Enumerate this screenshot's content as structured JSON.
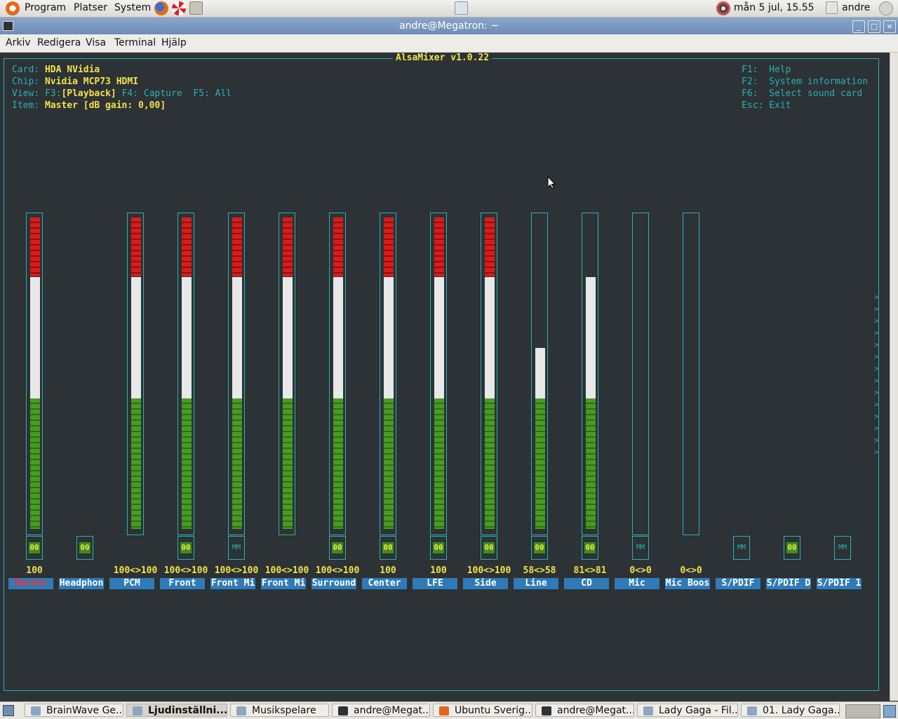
{
  "top_panel": {
    "menus": [
      "Program",
      "Platser",
      "System"
    ],
    "clock": "mån  5 jul, 15.55",
    "user": "andre",
    "icons": [
      "ubuntu-logo-icon",
      "firefox-icon",
      "help-lifebuoy-icon",
      "home-folder-icon",
      "screenshot-tool-icon",
      "volume-icon",
      "user-icon",
      "power-icon"
    ]
  },
  "window": {
    "title": "andre@Megatron: ~"
  },
  "menubar": [
    "Arkiv",
    "Redigera",
    "Visa",
    "Terminal",
    "Hjälp"
  ],
  "mixer": {
    "title": "AlsaMixer v1.0.22",
    "card_label": "Card:",
    "card": "HDA NVidia",
    "chip_label": "Chip:",
    "chip": "Nvidia MCP73 HDMI",
    "view_label": "View:",
    "f3": "F3:",
    "view_playback": "[Playback]",
    "view_capture": "F4: Capture",
    "view_all": "F5: All",
    "item_label": "Item:",
    "item": "Master [dB gain: 0,00]",
    "help": [
      {
        "key": "F1:",
        "text": "Help"
      },
      {
        "key": "F2:",
        "text": "System information"
      },
      {
        "key": "F6:",
        "text": "Select sound card"
      },
      {
        "key": "Esc:",
        "text": "Exit"
      }
    ],
    "channels": [
      {
        "name": "Master",
        "volume": "100",
        "level": 100,
        "has_bar": true,
        "switch": "00",
        "selected": true
      },
      {
        "name": "Headphon",
        "volume": "",
        "level": 0,
        "has_bar": false,
        "switch": "00"
      },
      {
        "name": "PCM",
        "volume": "100<>100",
        "level": 100,
        "has_bar": true,
        "switch": ""
      },
      {
        "name": "Front",
        "volume": "100<>100",
        "level": 100,
        "has_bar": true,
        "switch": "00"
      },
      {
        "name": "Front Mi",
        "volume": "100<>100",
        "level": 100,
        "has_bar": true,
        "switch": "MM"
      },
      {
        "name": "Front Mi",
        "volume": "100<>100",
        "level": 100,
        "has_bar": true,
        "switch": ""
      },
      {
        "name": "Surround",
        "volume": "100<>100",
        "level": 100,
        "has_bar": true,
        "switch": "00"
      },
      {
        "name": "Center",
        "volume": "100",
        "level": 100,
        "has_bar": true,
        "switch": "00"
      },
      {
        "name": "LFE",
        "volume": "100",
        "level": 100,
        "has_bar": true,
        "switch": "00"
      },
      {
        "name": "Side",
        "volume": "100<>100",
        "level": 100,
        "has_bar": true,
        "switch": "00"
      },
      {
        "name": "Line",
        "volume": "58<>58",
        "level": 58,
        "has_bar": true,
        "switch": "00"
      },
      {
        "name": "CD",
        "volume": "81<>81",
        "level": 81,
        "has_bar": true,
        "switch": "00"
      },
      {
        "name": "Mic",
        "volume": "0<>0",
        "level": 0,
        "has_bar": true,
        "switch": "MM"
      },
      {
        "name": "Mic Boos",
        "volume": "0<>0",
        "level": 0,
        "has_bar": true,
        "switch": ""
      },
      {
        "name": "S/PDIF",
        "volume": "",
        "level": 0,
        "has_bar": false,
        "switch": "MM"
      },
      {
        "name": "S/PDIF D",
        "volume": "",
        "level": 0,
        "has_bar": false,
        "switch": "00"
      },
      {
        "name": "S/PDIF 1",
        "volume": "",
        "level": 0,
        "has_bar": false,
        "switch": "MM"
      }
    ]
  },
  "taskbar": [
    {
      "label": "BrainWave Ge...",
      "icon": "brainwave-icon"
    },
    {
      "label": "Ljudinställni...",
      "icon": "sound-settings-icon",
      "active": true
    },
    {
      "label": "Musikspelare",
      "icon": "music-player-icon"
    },
    {
      "label": "andre@Megat...",
      "icon": "terminal-icon"
    },
    {
      "label": "Ubuntu Sverig...",
      "icon": "firefox-icon"
    },
    {
      "label": "andre@Megat...",
      "icon": "terminal-icon"
    },
    {
      "label": "Lady Gaga - Fil...",
      "icon": "file-manager-icon"
    },
    {
      "label": "01. Lady Gaga...",
      "icon": "media-player-icon"
    }
  ]
}
